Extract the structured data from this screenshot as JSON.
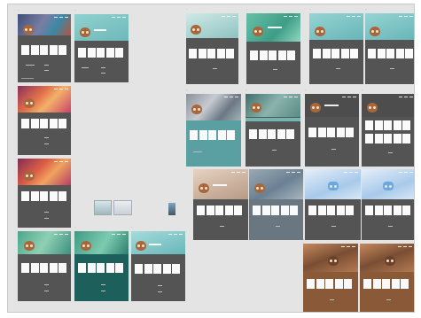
{
  "canvas": {
    "background": "#e4e4e4"
  },
  "frames": [
    {
      "name": "frame-1",
      "hero": "#6a7898",
      "body": "#545454"
    },
    {
      "name": "frame-2",
      "hero": "#7cc2c4",
      "body": "#545454"
    },
    {
      "name": "frame-3",
      "hero": "#d87a4e",
      "body": "#545454"
    },
    {
      "name": "frame-4",
      "hero": "#d0674a",
      "body": "#545454"
    },
    {
      "name": "frame-5",
      "hero": "#6fb79f",
      "body": "#545454"
    },
    {
      "name": "frame-6",
      "hero": "#5faf9a",
      "body": "#1d5f5b"
    },
    {
      "name": "frame-7",
      "hero": "#7fc6c6",
      "body": "#545454"
    },
    {
      "name": "frame-8",
      "hero": "#9fcbc8",
      "body": "#545454"
    },
    {
      "name": "frame-9",
      "hero": "#58b49a",
      "body": "#545454"
    },
    {
      "name": "frame-10",
      "hero": "#7fc6c6",
      "body": "#545454"
    },
    {
      "name": "frame-11",
      "hero": "#7fc6c6",
      "body": "#545454"
    },
    {
      "name": "frame-12",
      "hero": "#7a8a8e",
      "body": "#5a9fa1"
    },
    {
      "name": "frame-13",
      "hero": "#6f9b94",
      "body": "#545454"
    },
    {
      "name": "frame-14",
      "hero": "#a8c9c6",
      "body": "#545454"
    },
    {
      "name": "frame-15",
      "hero": "#a8c9c6",
      "body": "#545454"
    },
    {
      "name": "frame-16",
      "hero": "#c7ab94",
      "body": "#545454"
    },
    {
      "name": "frame-17",
      "hero": "#7c92a4",
      "body": "#6a7680"
    },
    {
      "name": "frame-18",
      "hero": "#c9dcef",
      "body": "#545454"
    },
    {
      "name": "frame-19",
      "hero": "#c9dcef",
      "body": "#545454"
    },
    {
      "name": "frame-20",
      "hero": "#a06a44",
      "body": "#8a5a38"
    },
    {
      "name": "frame-21",
      "hero": "#a06a44",
      "body": "#8a5a38"
    }
  ],
  "thumbnails": [
    {
      "name": "thumbnail-landscape",
      "color": "#b7c9cf"
    },
    {
      "name": "thumbnail-portrait",
      "color": "#5b6f80"
    }
  ]
}
